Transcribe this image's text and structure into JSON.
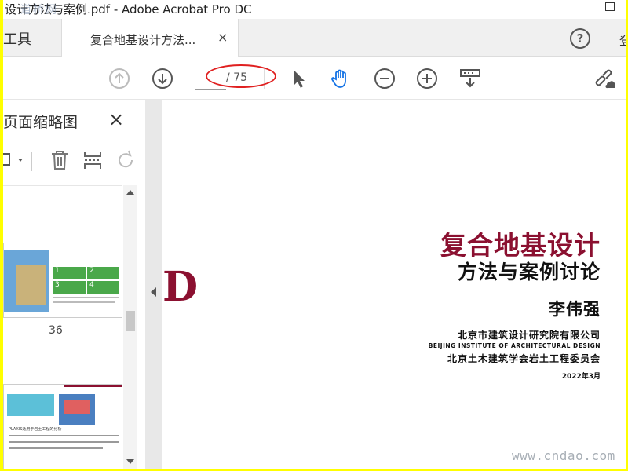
{
  "window": {
    "title": "设计方法与案例.pdf - Adobe Acrobat Pro DC",
    "title_watermark": "道桥网"
  },
  "tabs": {
    "tools_label": "工具",
    "document_tab_label": "复合地基设计方法...",
    "close_glyph": "×",
    "help_glyph": "?",
    "signin_partial": "登"
  },
  "toolbar": {
    "current_page": "",
    "page_total": "/ 75",
    "icons": [
      "prev-page-icon",
      "next-page-icon",
      "select-cursor-icon",
      "hand-tool-icon",
      "zoom-out-icon",
      "zoom-in-icon",
      "page-display-icon",
      "share-link-icon"
    ]
  },
  "thumbnails": {
    "panel_title": "页面缩略图",
    "close_glyph": "×",
    "page_labels": [
      "36"
    ],
    "thumb_steps": [
      "1",
      "2",
      "3",
      "4"
    ],
    "thumb_caption": "PLAXIS适用于岩土工程的分析"
  },
  "document": {
    "side_letter": "D",
    "title_line1": "复合地基设计",
    "title_line2": "方法与案例讨论",
    "author": "李伟强",
    "org_line1": "北京市建筑设计研究院有限公司",
    "org_line2": "BEIJING INSTITUTE OF ARCHITECTURAL DESIGN",
    "org_line3": "北京土木建筑学会岩土工程委员会",
    "date": "2022年3月"
  },
  "overlay": {
    "watermark": "www.cndao.com"
  },
  "colors": {
    "frame_border": "#ffff00",
    "title_accent": "#8b1030",
    "annotation_red": "#e02020",
    "hand_tool_blue": "#1473e6"
  }
}
